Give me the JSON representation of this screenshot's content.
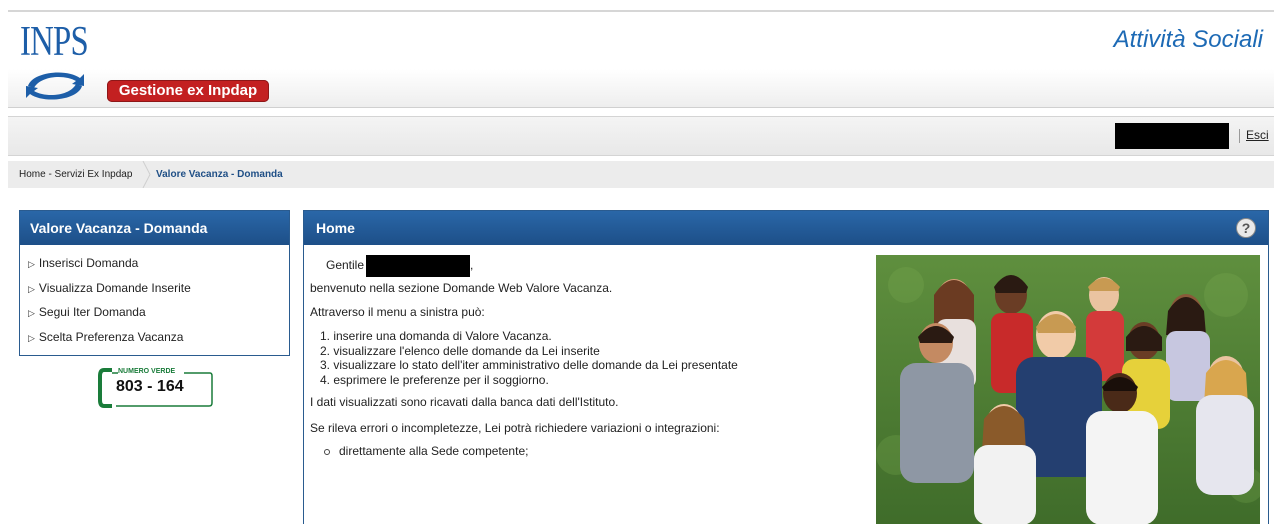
{
  "header": {
    "logo_text": "INPS",
    "badge": "Gestione ex Inpdap",
    "app_title": "Attività Sociali"
  },
  "user_bar": {
    "logout": "Esci"
  },
  "breadcrumb": {
    "items": [
      "Home - Servizi Ex Inpdap",
      "Valore Vacanza - Domanda"
    ]
  },
  "sidebar": {
    "title": "Valore Vacanza - Domanda",
    "items": [
      {
        "label": "Inserisci Domanda"
      },
      {
        "label": "Visualizza Domande Inserite"
      },
      {
        "label": "Segui Iter Domanda"
      },
      {
        "label": "Scelta Preferenza Vacanza"
      }
    ],
    "numero_verde": {
      "label": "NUMERO VERDE",
      "number": "803 - 164"
    }
  },
  "main": {
    "title": "Home",
    "help_icon": "?",
    "greeting": "Gentile",
    "welcome": "benvenuto nella sezione Domande Web Valore Vacanza.",
    "intro": "Attraverso il menu a sinistra può:",
    "steps": [
      "1. inserire una domanda di Valore Vacanza.",
      "2. visualizzare l'elenco delle domande da Lei inserite",
      "3. visualizzare lo stato dell'iter amministrativo delle domande da Lei presentate",
      "4. esprimere le preferenze per il soggiorno."
    ],
    "data_note": "I dati visualizzati sono ricavati dalla banca dati dell'Istituto.",
    "errors_note": "Se rileva errori o incompletezze, Lei potrà richiedere variazioni o integrazioni:",
    "contact_item": "direttamente alla Sede competente;"
  },
  "colors": {
    "brand_blue": "#1f5490",
    "inps_blue": "#1d5ea8",
    "badge_red": "#c32021",
    "title_blue": "#1d6ab5",
    "green": "#1a7c3a"
  },
  "icons": {
    "help": "help-icon",
    "menu_arrow": "triangle-right-icon",
    "phone": "phone-icon"
  }
}
